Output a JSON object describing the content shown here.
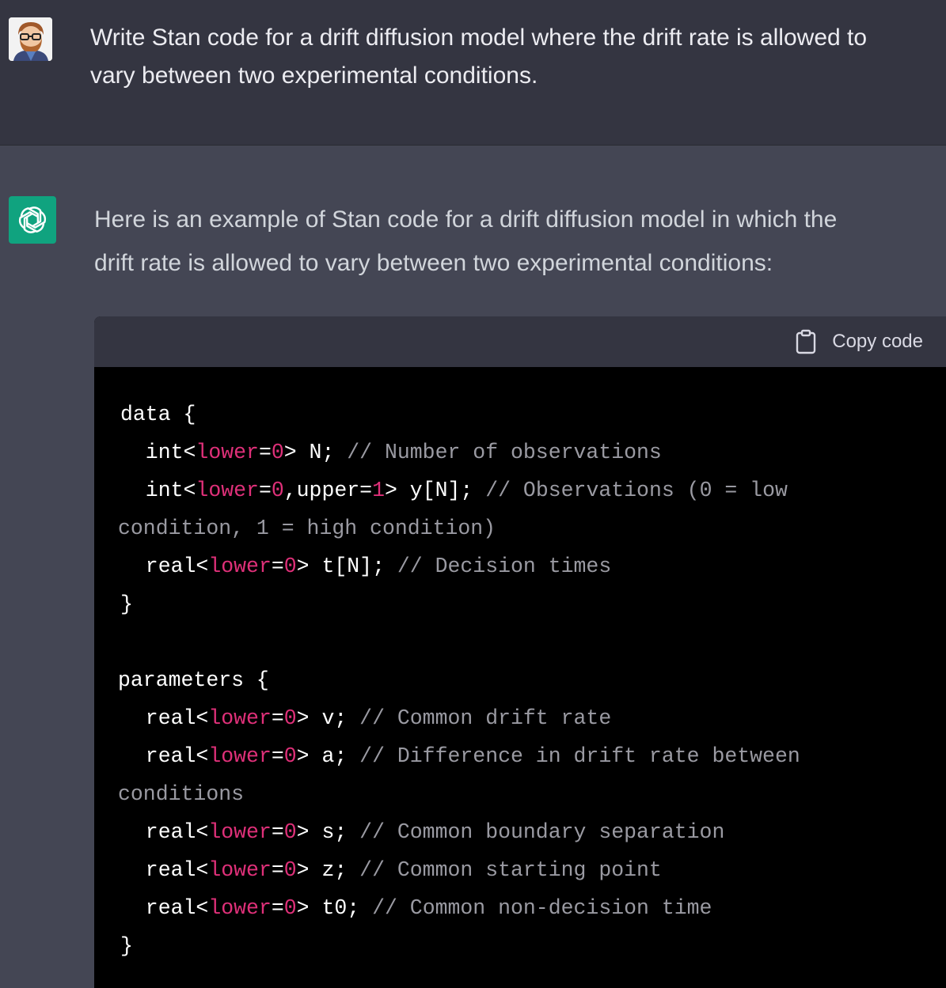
{
  "user": {
    "avatar_icon": "user-avatar-icon",
    "message_line1": "Write Stan code for a drift diffusion model where the drift rate is allowed to",
    "message_line2": "vary between two experimental conditions."
  },
  "assistant": {
    "avatar_icon": "openai-logo-icon",
    "message_line1": "Here is an example of Stan code for a drift diffusion model in which the",
    "message_line2": "drift rate is allowed to vary between two experimental conditions:"
  },
  "code_block": {
    "copy_label": "Copy code",
    "copy_icon": "clipboard-icon",
    "lines": {
      "l1_open": "data {",
      "l2_kw": "  int<",
      "l2_bound": "lower",
      "l2_eq": "=",
      "l2_num": "0",
      "l2_rest": "> N; ",
      "l2_comment": "// Number of observations",
      "l3_kw": "  int<",
      "l3_bound1": "lower",
      "l3_eq1": "=",
      "l3_num1": "0",
      "l3_mid": ",upper=",
      "l3_num2": "1",
      "l3_rest": "> y[N]; ",
      "l3_comment": "// Observations (0 = low",
      "l4_comment": "condition, 1 = high condition)",
      "l5_kw": "  real<",
      "l5_bound": "lower",
      "l5_eq": "=",
      "l5_num": "0",
      "l5_rest": "> t[N]; ",
      "l5_comment": "// Decision times",
      "l6_close": "}",
      "l8_open": "parameters {",
      "l9_kw": "  real<",
      "l9_bound": "lower",
      "l9_eq": "=",
      "l9_num": "0",
      "l9_rest": "> v; ",
      "l9_comment": "// Common drift rate",
      "l10_kw": "  real<",
      "l10_bound": "lower",
      "l10_eq": "=",
      "l10_num": "0",
      "l10_rest": "> a; ",
      "l10_comment": "// Difference in drift rate between",
      "l11_comment": "conditions",
      "l12_kw": "  real<",
      "l12_bound": "lower",
      "l12_eq": "=",
      "l12_num": "0",
      "l12_rest": "> s; ",
      "l12_comment": "// Common boundary separation",
      "l13_kw": "  real<",
      "l13_bound": "lower",
      "l13_eq": "=",
      "l13_num": "0",
      "l13_rest": "> z; ",
      "l13_comment": "// Common starting point",
      "l14_kw": "  real<",
      "l14_bound": "lower",
      "l14_eq": "=",
      "l14_num": "0",
      "l14_rest": "> t0; ",
      "l14_comment": "// Common non-decision time",
      "l15_close": "}"
    }
  },
  "colors": {
    "user_bg": "#343541",
    "assistant_bg": "#444654",
    "code_bg": "#000000",
    "code_header_bg": "#343541",
    "bound_keyword": "#df3079",
    "comment": "#9a9aa2",
    "openai_green": "#10a37f"
  }
}
